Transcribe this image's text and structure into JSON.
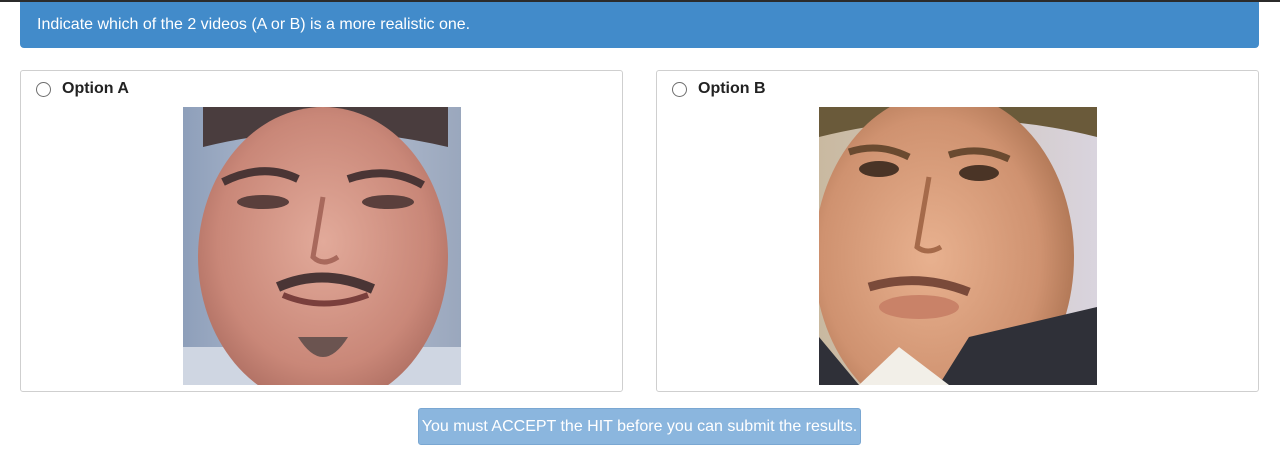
{
  "instruction": "Indicate which of the 2 videos (A or B) is a more realistic one.",
  "options": [
    {
      "label": "Option A",
      "media": "face-video-thumbnail"
    },
    {
      "label": "Option B",
      "media": "face-video-thumbnail"
    }
  ],
  "submit_label": "You must ACCEPT the HIT before you can submit the results.",
  "colors": {
    "banner": "#428bca",
    "button": "#8bb6de"
  }
}
